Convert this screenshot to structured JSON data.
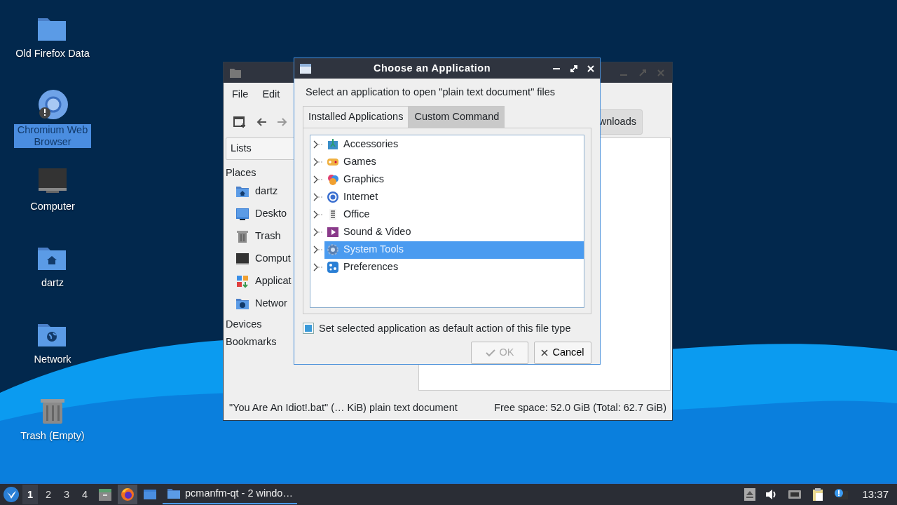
{
  "desktop_icons": [
    {
      "label": "Old Firefox Data",
      "selected": false
    },
    {
      "label": "Chromium Web Browser",
      "selected": true
    },
    {
      "label": "Computer",
      "selected": false
    },
    {
      "label": "dartz",
      "selected": false
    },
    {
      "label": "Network",
      "selected": false
    },
    {
      "label": "Trash (Empty)",
      "selected": false
    }
  ],
  "file_manager": {
    "menu": [
      "File",
      "Edit"
    ],
    "path_button": "wnloads",
    "side_pane_mode": "Lists",
    "places_heading": "Places",
    "places": [
      "dartz",
      "Deskto",
      "Trash",
      "Comput",
      "Applicat",
      "Networ"
    ],
    "sections": [
      "Devices",
      "Bookmarks"
    ],
    "status_left": "\"You Are An Idiot!.bat\" (… KiB) plain text document",
    "status_right": "Free space: 52.0 GiB (Total: 62.7 GiB)"
  },
  "dialog": {
    "title": "Choose an Application",
    "prompt": "Select an application to open \"plain text document\" files",
    "tabs": [
      {
        "label": "Installed Applications",
        "selected": true
      },
      {
        "label": "Custom Command",
        "selected": false
      }
    ],
    "categories": [
      {
        "label": "Accessories",
        "expanded": false,
        "selected": false
      },
      {
        "label": "Games",
        "expanded": false,
        "selected": false
      },
      {
        "label": "Graphics",
        "expanded": false,
        "selected": false
      },
      {
        "label": "Internet",
        "expanded": false,
        "selected": false
      },
      {
        "label": "Office",
        "expanded": false,
        "selected": false
      },
      {
        "label": "Sound & Video",
        "expanded": false,
        "selected": false
      },
      {
        "label": "System Tools",
        "expanded": false,
        "selected": true
      },
      {
        "label": "Preferences",
        "expanded": false,
        "selected": false
      }
    ],
    "default_checkbox": {
      "label": "Set selected application as default action of this file type",
      "checked": true
    },
    "buttons": [
      {
        "label": "OK",
        "kind": "ok",
        "disabled": true
      },
      {
        "label": "Cancel",
        "kind": "cancel",
        "disabled": false
      }
    ]
  },
  "taskbar": {
    "workspaces": [
      {
        "label": "1",
        "selected": true
      },
      {
        "label": "2",
        "selected": false
      },
      {
        "label": "3",
        "selected": false
      },
      {
        "label": "4",
        "selected": false
      }
    ],
    "launchers": [
      {
        "selected": false
      },
      {
        "selected": true
      },
      {
        "selected": false
      }
    ],
    "task": {
      "label": "pcmanfm-qt - 2 windo…",
      "selected": true
    },
    "clock": "13:37"
  }
}
